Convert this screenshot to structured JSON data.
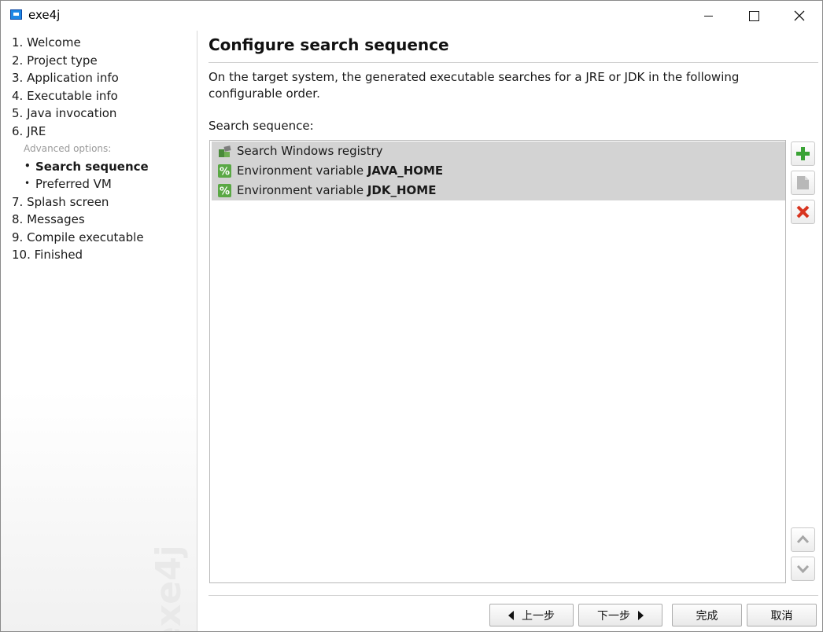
{
  "window": {
    "title": "exe4j"
  },
  "sidebar": {
    "items": [
      {
        "label": "1. Welcome"
      },
      {
        "label": "2. Project type"
      },
      {
        "label": "3. Application info"
      },
      {
        "label": "4. Executable info"
      },
      {
        "label": "5. Java invocation"
      },
      {
        "label": "6. JRE"
      }
    ],
    "advanced_header": "Advanced options:",
    "sub_items": [
      {
        "label": "Search sequence",
        "active": true
      },
      {
        "label": "Preferred VM",
        "active": false
      }
    ],
    "items_after": [
      {
        "label": "7. Splash screen"
      },
      {
        "label": "8. Messages"
      },
      {
        "label": "9. Compile executable"
      },
      {
        "label": "10. Finished"
      }
    ],
    "watermark": "exe4j"
  },
  "main": {
    "title": "Configure search sequence",
    "description": "On the target system, the generated executable searches for a JRE or JDK in the following configurable order.",
    "list_label": "Search sequence:",
    "entries": [
      {
        "prefix": "Search Windows registry",
        "bold": "",
        "icon": "registry-icon"
      },
      {
        "prefix": "Environment variable ",
        "bold": "JAVA_HOME",
        "icon": "percent-icon"
      },
      {
        "prefix": "Environment variable ",
        "bold": "JDK_HOME",
        "icon": "percent-icon"
      }
    ],
    "side_buttons": [
      "add-icon",
      "edit-icon",
      "delete-icon",
      "move-up-icon",
      "move-down-icon"
    ]
  },
  "footer": {
    "back_label": "上一步",
    "next_label": "下一步",
    "finish_label": "完成",
    "cancel_label": "取消"
  },
  "colors": {
    "add": "#3aa335",
    "delete": "#d8341f",
    "selection": "#d3d3d3"
  }
}
